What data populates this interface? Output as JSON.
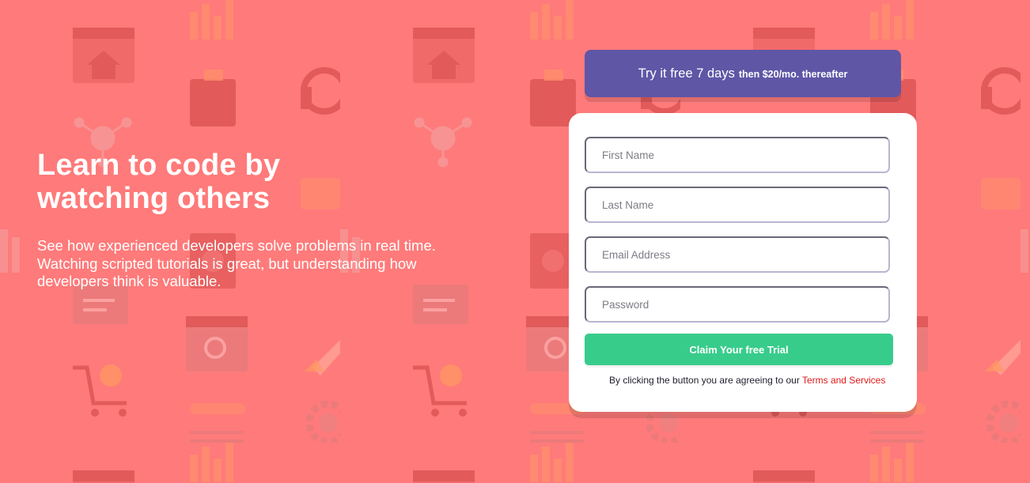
{
  "hero": {
    "title": "Learn to code by watching others",
    "description": "See how experienced developers solve problems in real time. Watching scripted tutorials is great, but understanding how developers think is valuable."
  },
  "promo": {
    "main": "Try it free 7 days",
    "sub": "then $20/mo. thereafter"
  },
  "form": {
    "first_name_placeholder": "First Name",
    "last_name_placeholder": "Last Name",
    "email_placeholder": "Email Address",
    "password_placeholder": "Password",
    "submit_label": "Claim Your free Trial",
    "terms_prefix": "By clicking the button you are agreeing to our",
    "terms_link": "Terms and Services"
  },
  "colors": {
    "background": "#ff7a7a",
    "promo": "#5f56a6",
    "cta": "#38cc8b",
    "link": "#e01818"
  }
}
